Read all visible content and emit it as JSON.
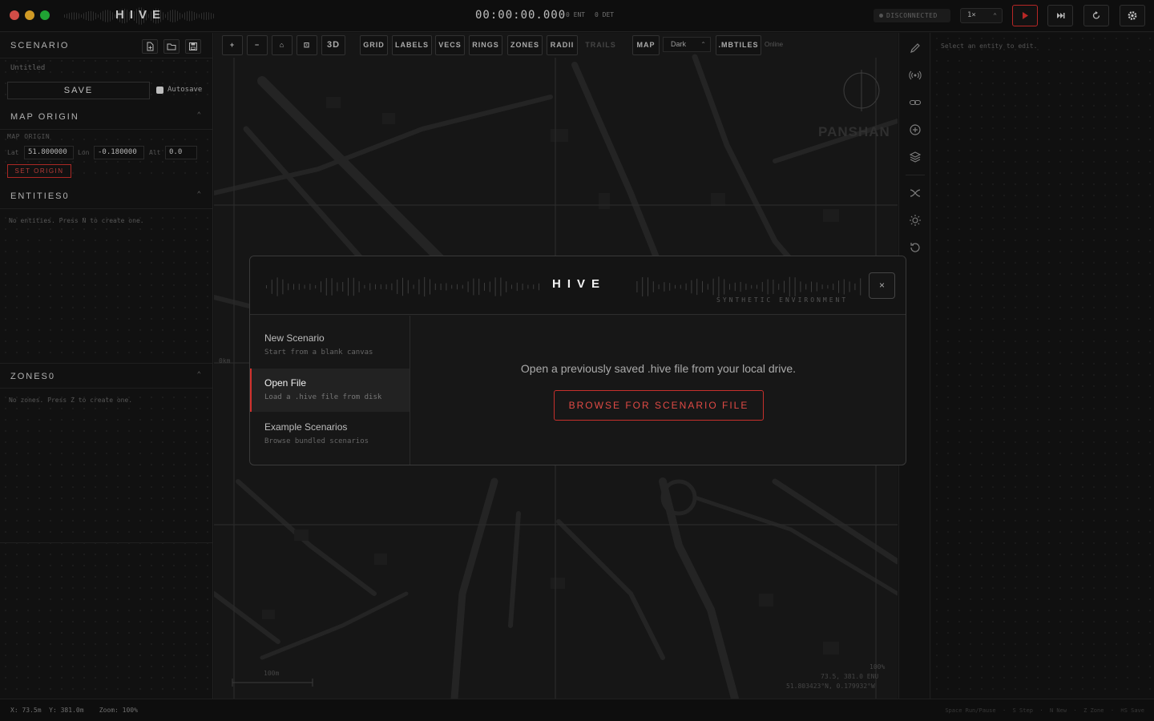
{
  "app": {
    "title": "HIVE"
  },
  "topbar": {
    "clock": "00:00:00.000",
    "ent": "0 ENT",
    "det": "0 DET",
    "connection": "DISCONNECTED",
    "speed": "1×",
    "icons": [
      "play-icon",
      "step-forward-icon",
      "reset-icon",
      "gear-icon"
    ],
    "accent": "#e0302f"
  },
  "left": {
    "scenario": {
      "header": "SCENARIO",
      "name": "Untitled",
      "save": "SAVE",
      "autosave": "Autosave"
    },
    "origin": {
      "header": "MAP ORIGIN",
      "sublabel": "MAP ORIGIN",
      "lat_label": "Lat",
      "lat": "51.800000",
      "lon_label": "Lon",
      "lon": "-0.180000",
      "alt_label": "Alt",
      "alt": "0.0",
      "set_button": "SET ORIGIN"
    },
    "entities": {
      "header": "ENTITIES",
      "count": "0",
      "empty": "No entities. Press N to create one."
    },
    "zones": {
      "header": "ZONES",
      "count": "0",
      "empty": "No zones. Press Z to create one."
    }
  },
  "map": {
    "toolbar": {
      "zoom_in": "+",
      "zoom_out": "−",
      "home": "⌂",
      "fit": "⊡",
      "view3d": "3D",
      "grid": "GRID",
      "labels": "LABELS",
      "vecs": "VECS",
      "rings": "RINGS",
      "zones": "ZONES",
      "radii": "RADII",
      "trails": "TRAILS",
      "map": "MAP",
      "style": "Dark",
      "mbtiles": ".MBTILES",
      "status": "Online"
    },
    "scale": "100m",
    "km": "0km",
    "zoom_pct": "100%",
    "enu": "73.5, 381.0 ENU",
    "latlon": "51.803423°N, 0.179932°W",
    "place": "PANSHAN"
  },
  "inspector": {
    "empty": "Select an entity to edit."
  },
  "status": {
    "coords": "X: 73.5m  Y: 381.0m    Zoom: 100%",
    "hints": "Space Run/Pause  ·  S Step  ·  N New  ·  Z Zone  ·  ⌘S Save"
  },
  "modal": {
    "title": "HIVE",
    "subtitle": "SYNTHETIC ENVIRONMENT",
    "close": "×",
    "nav": [
      {
        "title": "New Scenario",
        "sub": "Start from a blank canvas"
      },
      {
        "title": "Open File",
        "sub": "Load a .hive file from disk"
      },
      {
        "title": "Example Scenarios",
        "sub": "Browse bundled scenarios"
      }
    ],
    "description": "Open a previously saved .hive file from your local drive.",
    "browse": "BROWSE FOR SCENARIO FILE"
  }
}
